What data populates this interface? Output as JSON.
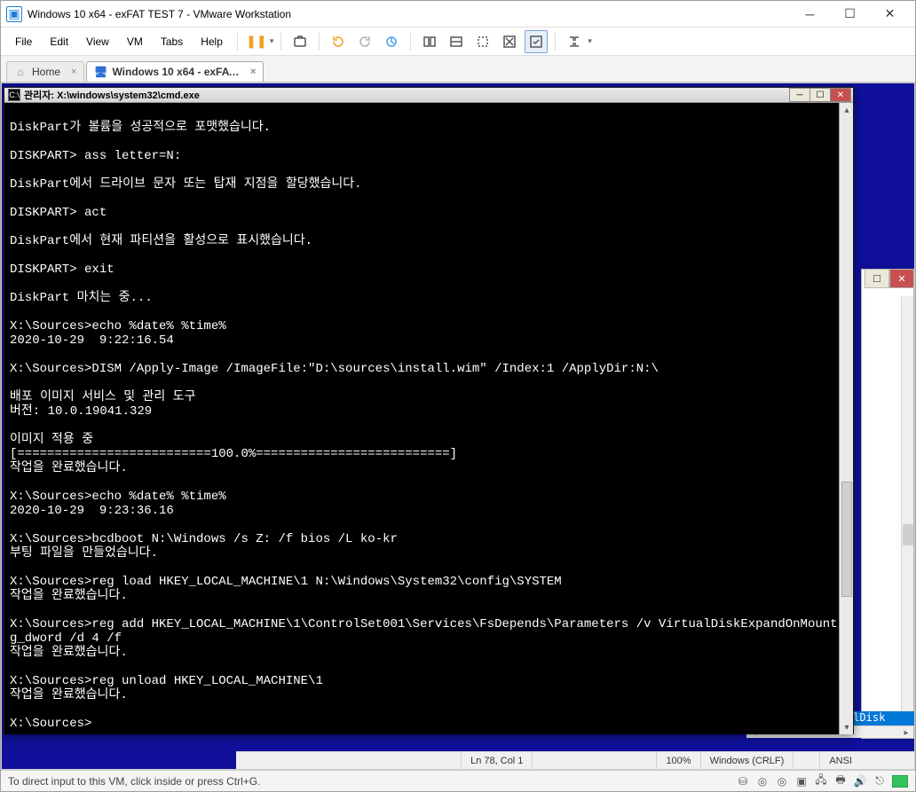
{
  "vmware": {
    "title": "Windows 10 x64 - exFAT TEST 7 - VMware Workstation",
    "menus": [
      "File",
      "Edit",
      "View",
      "VM",
      "Tabs",
      "Help"
    ],
    "tabs": [
      {
        "label": "Home",
        "icon": "home-icon",
        "active": false
      },
      {
        "label": "Windows 10 x64 - exFAT T...",
        "icon": "monitor-icon",
        "active": true
      }
    ],
    "hint": "To direct input to this VM, click inside or press Ctrl+G."
  },
  "notepad_status": {
    "position": "Ln 78, Col 1",
    "zoom": "100%",
    "eol": "Windows (CRLF)",
    "encoding": "ANSI"
  },
  "notepad_remnant": {
    "selected_text": "alDisk",
    "slashes": "//////"
  },
  "cmd": {
    "title": "관리자: X:\\windows\\system32\\cmd.exe",
    "lines": [
      "",
      "DiskPart가 볼륨을 성공적으로 포맷했습니다.",
      "",
      "DISKPART> ass letter=N:",
      "",
      "DiskPart에서 드라이브 문자 또는 탑재 지점을 할당했습니다.",
      "",
      "DISKPART> act",
      "",
      "DiskPart에서 현재 파티션을 활성으로 표시했습니다.",
      "",
      "DISKPART> exit",
      "",
      "DiskPart 마치는 중...",
      "",
      "X:\\Sources>echo %date% %time%",
      "2020-10-29  9:22:16.54",
      "",
      "X:\\Sources>DISM /Apply-Image /ImageFile:\"D:\\sources\\install.wim\" /Index:1 /ApplyDir:N:\\",
      "",
      "배포 이미지 서비스 및 관리 도구",
      "버전: 10.0.19041.329",
      "",
      "이미지 적용 중",
      "[==========================100.0%==========================]",
      "작업을 완료했습니다.",
      "",
      "X:\\Sources>echo %date% %time%",
      "2020-10-29  9:23:36.16",
      "",
      "X:\\Sources>bcdboot N:\\Windows /s Z: /f bios /L ko-kr",
      "부팅 파일을 만들었습니다.",
      "",
      "X:\\Sources>reg load HKEY_LOCAL_MACHINE\\1 N:\\Windows\\System32\\config\\SYSTEM",
      "작업을 완료했습니다.",
      "",
      "X:\\Sources>reg add HKEY_LOCAL_MACHINE\\1\\ControlSet001\\Services\\FsDepends\\Parameters /v VirtualDiskExpandOnMount /t re",
      "g_dword /d 4 /f",
      "작업을 완료했습니다.",
      "",
      "X:\\Sources>reg unload HKEY_LOCAL_MACHINE\\1",
      "작업을 완료했습니다.",
      "",
      "X:\\Sources>"
    ]
  }
}
